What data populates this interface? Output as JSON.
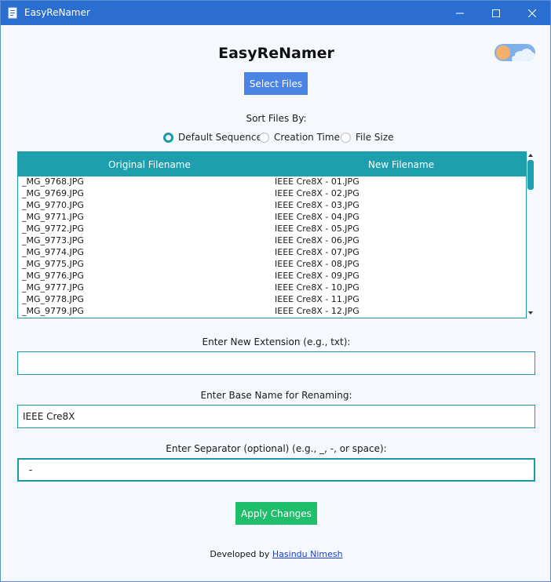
{
  "window": {
    "title": "EasyReNamer"
  },
  "header": {
    "title": "EasyReNamer",
    "select_files_label": "Select Files"
  },
  "theme_toggle": {
    "mode": "light",
    "icon": "sun-cloud-icon"
  },
  "sort": {
    "label": "Sort Files By:",
    "options": [
      {
        "label": "Default Sequence",
        "checked": true
      },
      {
        "label": "Creation Time",
        "checked": false
      },
      {
        "label": "File Size",
        "checked": false
      }
    ]
  },
  "table": {
    "columns": [
      "Original Filename",
      "New Filename"
    ],
    "rows": [
      [
        "_MG_9768.JPG",
        "IEEE Cre8X - 01.JPG"
      ],
      [
        "_MG_9769.JPG",
        "IEEE Cre8X - 02.JPG"
      ],
      [
        "_MG_9770.JPG",
        "IEEE Cre8X - 03.JPG"
      ],
      [
        "_MG_9771.JPG",
        "IEEE Cre8X - 04.JPG"
      ],
      [
        "_MG_9772.JPG",
        "IEEE Cre8X - 05.JPG"
      ],
      [
        "_MG_9773.JPG",
        "IEEE Cre8X - 06.JPG"
      ],
      [
        "_MG_9774.JPG",
        "IEEE Cre8X - 07.JPG"
      ],
      [
        "_MG_9775.JPG",
        "IEEE Cre8X - 08.JPG"
      ],
      [
        "_MG_9776.JPG",
        "IEEE Cre8X - 09.JPG"
      ],
      [
        "_MG_9777.JPG",
        "IEEE Cre8X - 10.JPG"
      ],
      [
        "_MG_9778.JPG",
        "IEEE Cre8X - 11.JPG"
      ],
      [
        "_MG_9779.JPG",
        "IEEE Cre8X - 12.JPG"
      ]
    ]
  },
  "fields": {
    "extension_label": "Enter New Extension (e.g., txt):",
    "extension_value": "",
    "base_name_label": "Enter Base Name for Renaming:",
    "base_name_value": "IEEE Cre8X",
    "separator_label": "Enter Separator (optional) (e.g., _, -, or space):",
    "separator_value": " - "
  },
  "actions": {
    "apply_label": "Apply Changes"
  },
  "footer": {
    "prefix": "Developed by ",
    "author": "Hasindu Nimesh"
  },
  "colors": {
    "accent": "#1d9fae",
    "select_button": "#4c84e6",
    "apply_button": "#1ebe6a",
    "titlebar": "#2a6fcf"
  }
}
